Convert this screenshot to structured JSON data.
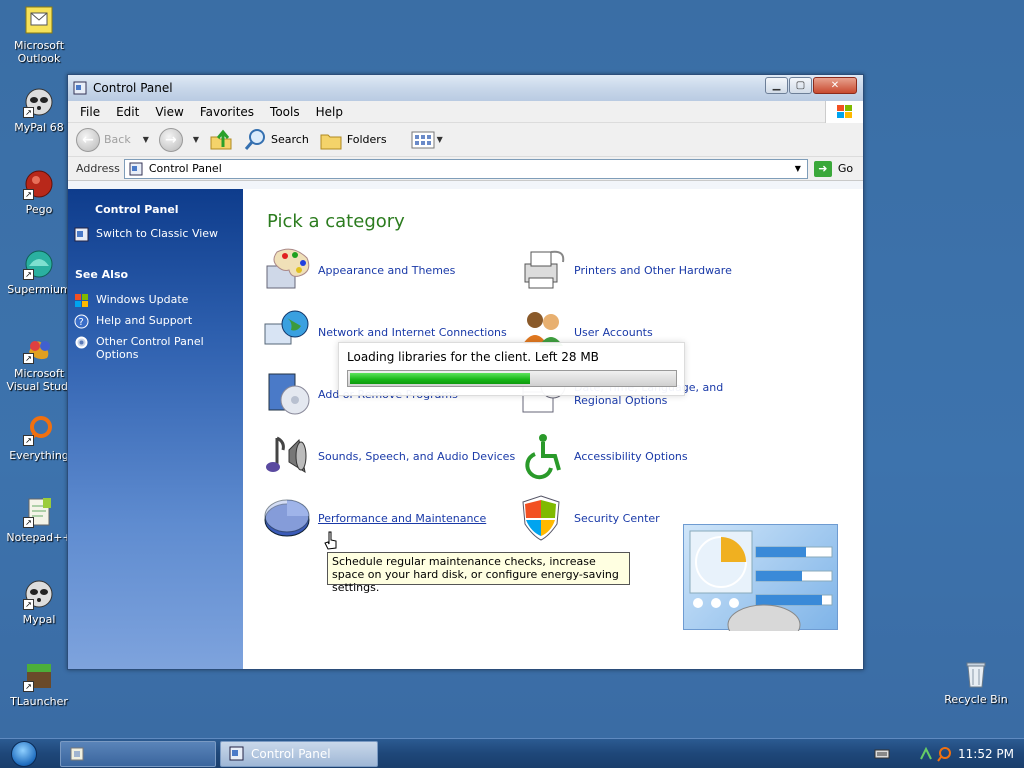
{
  "desktop": {
    "icons": [
      {
        "label": "Microsoft Outlook",
        "icon": "outlook-icon"
      },
      {
        "label": "MyPal 68",
        "icon": "mypal-icon"
      },
      {
        "label": "Pego",
        "icon": "pego-icon"
      },
      {
        "label": "Supermium",
        "icon": "supermium-icon"
      },
      {
        "label": "Microsoft Visual Stud.",
        "icon": "visual-studio-icon"
      },
      {
        "label": "Everything",
        "icon": "everything-icon"
      },
      {
        "label": "Notepad++",
        "icon": "notepadpp-icon"
      },
      {
        "label": "Mypal",
        "icon": "mypal-icon"
      },
      {
        "label": "TLauncher",
        "icon": "tlauncher-icon"
      },
      {
        "label": "Recycle Bin",
        "icon": "recycle-bin-icon"
      }
    ]
  },
  "window": {
    "title": "Control Panel",
    "menu": [
      "File",
      "Edit",
      "View",
      "Favorites",
      "Tools",
      "Help"
    ],
    "toolbar": {
      "back_label": "Back",
      "search_label": "Search",
      "folders_label": "Folders"
    },
    "address": {
      "label": "Address",
      "value": "Control Panel",
      "go_label": "Go"
    },
    "left_pane": {
      "title": "Control Panel",
      "switch_label": "Switch to Classic View",
      "see_also_title": "See Also",
      "see_also": [
        {
          "label": "Windows Update",
          "icon": "windows-update-icon"
        },
        {
          "label": "Help and Support",
          "icon": "help-icon"
        },
        {
          "label": "Other Control Panel Options",
          "icon": "gear-icon"
        }
      ]
    },
    "main": {
      "heading": "Pick a category",
      "categories": [
        {
          "label": "Appearance and Themes",
          "icon": "appearance-icon"
        },
        {
          "label": "Printers and Other Hardware",
          "icon": "printer-icon"
        },
        {
          "label": "Network and Internet Connections",
          "icon": "network-icon"
        },
        {
          "label": "User Accounts",
          "icon": "user-accounts-icon"
        },
        {
          "label": "Add or Remove Programs",
          "icon": "add-remove-icon"
        },
        {
          "label": "Date, Time, Language, and Regional Options",
          "icon": "date-time-icon"
        },
        {
          "label": "Sounds, Speech, and Audio Devices",
          "icon": "sound-icon"
        },
        {
          "label": "Accessibility Options",
          "icon": "accessibility-icon"
        },
        {
          "label": "Performance and Maintenance",
          "icon": "performance-icon"
        },
        {
          "label": "Security Center",
          "icon": "shield-icon"
        }
      ],
      "tooltip": "Schedule regular maintenance checks, increase space on your hard disk, or configure energy-saving settings."
    }
  },
  "loading": {
    "text": "Loading libraries for the client. Left 28 MB",
    "progress_percent": 56
  },
  "taskbar": {
    "tasks": [
      "",
      "Control Panel"
    ],
    "clock": "11:52 PM"
  },
  "colors": {
    "desktop": "#3a6ea5",
    "heading_green": "#2c7c1f",
    "link_blue": "#1a3aa8",
    "progress_green": "#17b517"
  }
}
